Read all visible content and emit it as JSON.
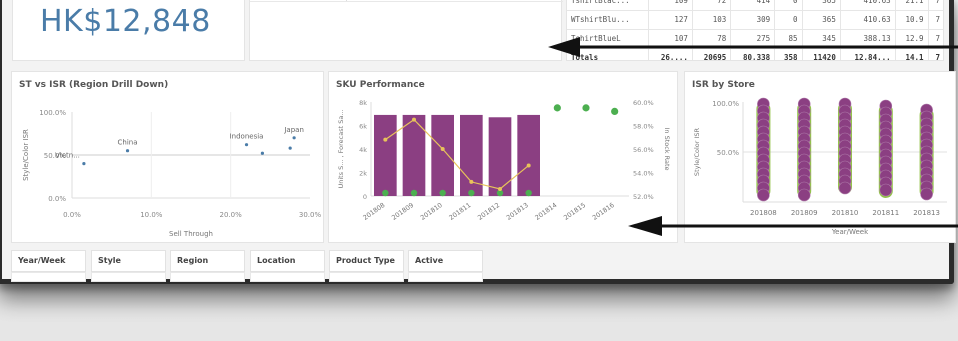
{
  "kpi": {
    "value": "HK$12,848"
  },
  "table": {
    "top_partial": [
      "",
      "",
      "",
      "",
      ""
    ],
    "rows": [
      {
        "name": "TshirtBlac...",
        "c": [
          "109",
          "72",
          "414",
          "0",
          "365",
          "410.63",
          "21.1",
          "7"
        ]
      },
      {
        "name": "WTshirtBlu...",
        "c": [
          "127",
          "103",
          "309",
          "0",
          "365",
          "410.63",
          "10.9",
          "7"
        ]
      },
      {
        "name": "TshirtBlueL",
        "c": [
          "107",
          "78",
          "275",
          "85",
          "345",
          "388.13",
          "12.9",
          "7"
        ]
      }
    ],
    "totals": {
      "name": "Totals",
      "c": [
        "26,...",
        "20695",
        "80,338",
        "358",
        "11420",
        "12,84...",
        "14.1",
        "7"
      ]
    }
  },
  "st_isr": {
    "title": "ST vs ISR (Region Drill Down)",
    "y_label": "Style/Color ISR",
    "x_label": "Sell Through",
    "y_ticks": [
      "100.0%",
      "50.0%",
      "0.0%"
    ],
    "x_ticks": [
      "0.0%",
      "10.0%",
      "20.0%",
      "30.0%"
    ],
    "points": [
      {
        "label": "Vietn...",
        "x": 1.5,
        "y": 40
      },
      {
        "label": "China",
        "x": 7,
        "y": 55
      },
      {
        "label": "Indonesia",
        "x": 22,
        "y": 62
      },
      {
        "label": "",
        "x": 24,
        "y": 52
      },
      {
        "label": "Japan",
        "x": 28,
        "y": 70
      },
      {
        "label": "",
        "x": 27.5,
        "y": 58
      }
    ]
  },
  "sku": {
    "title": "SKU Performance",
    "y_left_label": "Units S... , Forecast Sa...",
    "y_right_label": "In Stock Rate",
    "y_left_ticks": [
      "8k",
      "6k",
      "4k",
      "2k",
      "0"
    ],
    "y_right_ticks": [
      "60.0%",
      "58.0%",
      "56.0%",
      "54.0%",
      "52.0%"
    ],
    "categories": [
      "201808",
      "201809",
      "201810",
      "201811",
      "201812",
      "201813",
      "201814",
      "201815",
      "201816"
    ],
    "bars": [
      6900,
      6900,
      6900,
      6900,
      6700,
      6900,
      null,
      null,
      null
    ],
    "line": [
      56.8,
      58.5,
      56.0,
      53.2,
      52.6,
      54.6,
      null,
      null,
      null
    ],
    "green_points": [
      {
        "i": 6,
        "y": 59.5
      },
      {
        "i": 7,
        "y": 59.5
      },
      {
        "i": 8,
        "y": 59.2
      }
    ]
  },
  "isr_store": {
    "title": "ISR by Store",
    "y_label": "Style/Color ISR",
    "x_label": "Year/Week",
    "y_ticks": [
      "100.0%",
      "50.0%"
    ],
    "categories": [
      "201808",
      "201809",
      "201810",
      "201811",
      "201813"
    ]
  },
  "filters": [
    "Year/Week",
    "Style",
    "Region",
    "Location",
    "Product Type",
    "Active"
  ],
  "colors": {
    "purple": "#8b3f82",
    "green": "#93c34a",
    "yellow": "#e8c35a",
    "dot": "#4a7ca8",
    "green_dot": "#4caf50"
  }
}
